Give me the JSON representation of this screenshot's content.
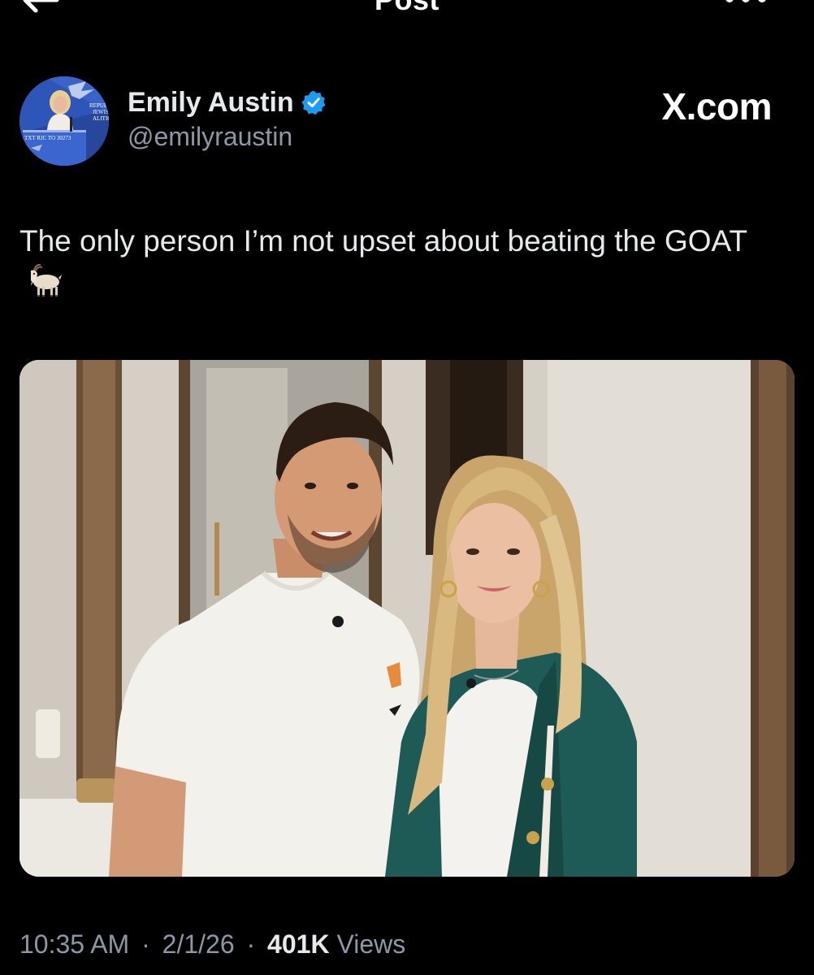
{
  "nav": {
    "title": "Post",
    "back_icon": "arrow-left-icon",
    "more_icon": "more-dots-icon"
  },
  "author": {
    "display_name": "Emily Austin",
    "handle": "@emilyraustin",
    "verified": true,
    "verified_color": "#1d9bf0",
    "avatar_text": {
      "line1": "REPUBLICAN",
      "line2": "JEWISH",
      "line3": "ALITION",
      "sign": "TXT RJC TO 30273"
    }
  },
  "source_label": "X.com",
  "post": {
    "text": "The only person I’m not upset about beating the GOAT",
    "emoji": "goat-emoji"
  },
  "media": {
    "type": "photo",
    "icon": "photo-two-people-posing"
  },
  "meta": {
    "time": "10:35 AM",
    "separator": "·",
    "date": "2/1/26",
    "views_count": "401K",
    "views_label": "Views"
  },
  "colors": {
    "background": "#000000",
    "text_primary": "#e7e9ea",
    "text_secondary": "#8b98a5",
    "accent": "#1d9bf0"
  }
}
